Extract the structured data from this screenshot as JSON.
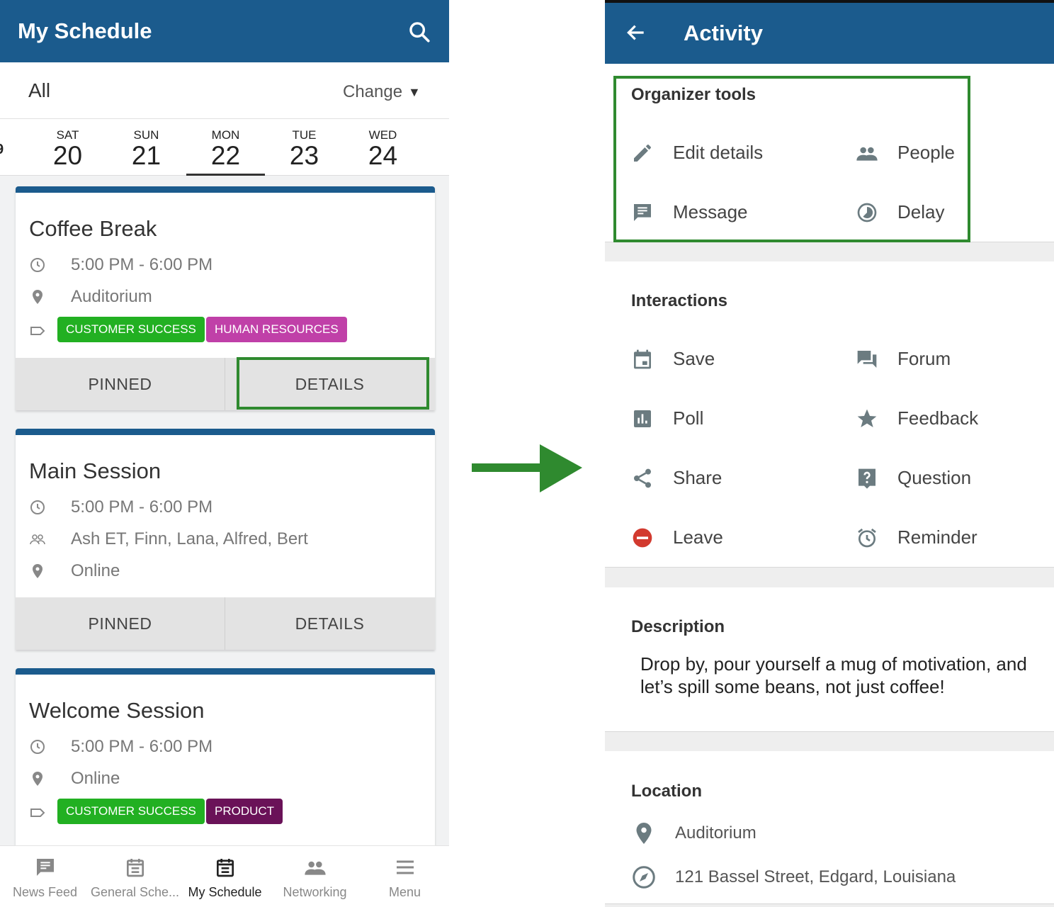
{
  "left": {
    "app_title": "My Schedule",
    "filter": {
      "label": "All",
      "change_label": "Change",
      "caret": "▼"
    },
    "days": [
      {
        "name": "SAT",
        "num": "20"
      },
      {
        "name": "SUN",
        "num": "21"
      },
      {
        "name": "MON",
        "num": "22"
      },
      {
        "name": "TUE",
        "num": "23"
      },
      {
        "name": "WED",
        "num": "24"
      }
    ],
    "sessions": [
      {
        "title": "Coffee Break",
        "time": "5:00 PM - 6:00 PM",
        "location": "Auditorium",
        "tags": [
          "CUSTOMER SUCCESS",
          "HUMAN RESOURCES"
        ],
        "pinned_label": "PINNED",
        "details_label": "DETAILS"
      },
      {
        "title": "Main Session",
        "time": "5:00 PM - 6:00 PM",
        "people": "Ash ET, Finn, Lana, Alfred, Bert",
        "location": "Online",
        "pinned_label": "PINNED",
        "details_label": "DETAILS"
      },
      {
        "title": "Welcome Session",
        "time": "5:00 PM - 6:00 PM",
        "location": "Online",
        "tags": [
          "CUSTOMER SUCCESS",
          "PRODUCT"
        ]
      }
    ],
    "nav": [
      "News Feed",
      "General Sche...",
      "My Schedule",
      "Networking",
      "Menu"
    ]
  },
  "right": {
    "app_title": "Activity",
    "organizer": {
      "heading": "Organizer tools",
      "items": [
        "Edit details",
        "People",
        "Message",
        "Delay"
      ]
    },
    "interactions": {
      "heading": "Interactions",
      "items": [
        "Save",
        "Forum",
        "Poll",
        "Feedback",
        "Share",
        "Question",
        "Leave",
        "Reminder"
      ]
    },
    "description": {
      "heading": "Description",
      "text": "Drop by, pour yourself a mug of motivation, and let’s spill some beans, not just coffee!"
    },
    "location": {
      "heading": "Location",
      "venue": "Auditorium",
      "address": "121 Bassel Street, Edgard, Louisiana"
    }
  },
  "colors": {
    "brand": "#1b5b8d",
    "highlight": "#2f8a2f",
    "tag_customer_success": "#22b022",
    "tag_human_resources": "#c040a8",
    "tag_product": "#6a1258",
    "leave_red": "#d23a2f"
  }
}
